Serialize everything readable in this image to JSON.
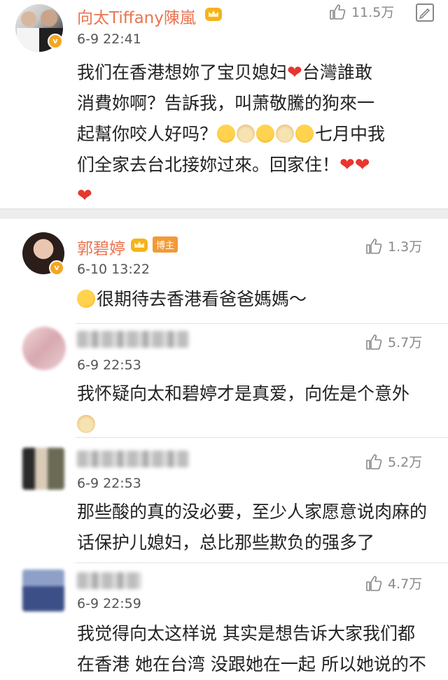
{
  "post": {
    "author": "向太Tiffany陳嵐",
    "time": "6-9 22:41",
    "likes": "11.5万",
    "lines": [
      "我们在香港想妳了宝贝媳妇",
      "台灣誰敢",
      "消費妳啊？告訴我，叫萧敬騰的狗來一",
      "起幫你咬人好吗？",
      "七月中我",
      "们全家去台北接妳过來。回家住！"
    ]
  },
  "comments": [
    {
      "author": "郭碧婷",
      "badge": "博主",
      "time": "6-10 13:22",
      "likes": "1.3万",
      "text": "很期待去香港看爸爸媽媽～"
    },
    {
      "author": "",
      "time": "6-9 22:53",
      "likes": "5.7万",
      "text": "我怀疑向太和碧婷才是真爱，向佐是个意外"
    },
    {
      "author": "",
      "time": "6-9 22:53",
      "likes": "5.2万",
      "text_line1": "那些酸的真的没必要，至少人家愿意说肉麻的",
      "text_line2": "话保护儿媳妇，总比那些欺负的强多了"
    },
    {
      "author": "",
      "time": "6-9 22:59",
      "likes": "4.7万",
      "text_line1": "我觉得向太这样说 其实是想告诉大家我们都",
      "text_line2": "在香港 她在台湾 没跟她在一起 所以她说的不"
    }
  ],
  "icons": {
    "like": "thumbs-up-icon",
    "edit": "edit-icon",
    "crown": "crown-badge-icon",
    "verified": "verified-v-icon"
  },
  "colors": {
    "name": "#eb7350",
    "heart": "#e8362e",
    "badge": "#f39a36",
    "verified": "#f5a623"
  }
}
